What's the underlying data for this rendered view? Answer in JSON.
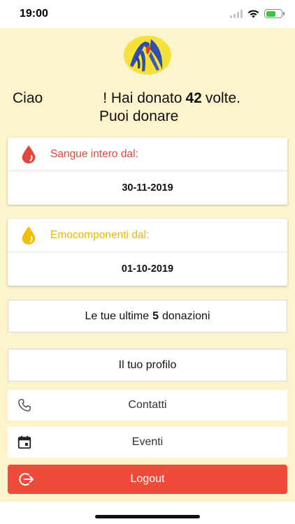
{
  "status_bar": {
    "time": "19:00"
  },
  "greeting": {
    "hello": "Ciao",
    "donated_prefix": "! Hai donato",
    "donation_count": "42",
    "donated_suffix": "volte.",
    "can_donate": "Puoi donare"
  },
  "whole_blood": {
    "label": "Sangue intero dal:",
    "date": "30-11-2019",
    "color": "#e0483b"
  },
  "blood_components": {
    "label": "Emocomponenti dal:",
    "date": "01-10-2019",
    "color": "#e6b800"
  },
  "last_donations": {
    "prefix": "Le tue ultime",
    "count": "5",
    "suffix": "donazioni"
  },
  "profile": {
    "label": "Il tuo profilo"
  },
  "contacts": {
    "label": "Contatti",
    "icon": "phone-icon"
  },
  "events": {
    "label": "Eventi",
    "icon": "calendar-icon"
  },
  "logout": {
    "label": "Logout",
    "icon": "logout-icon",
    "color": "#ef4a3c"
  },
  "theme": {
    "background": "#fdf3cc"
  }
}
